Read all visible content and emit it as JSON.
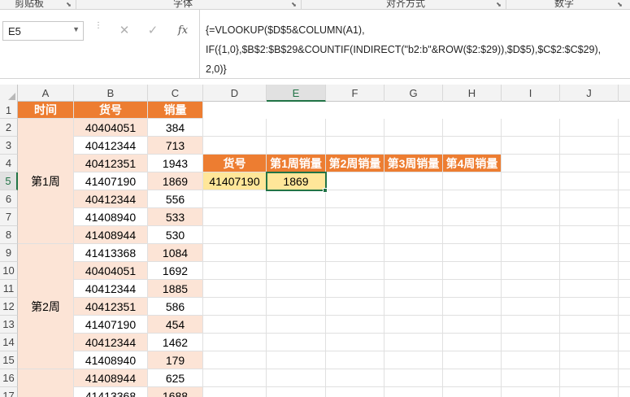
{
  "ribbon": {
    "groups": [
      {
        "label": "剪贴板"
      },
      {
        "label": "字体"
      },
      {
        "label": "对齐方式"
      },
      {
        "label": "数字"
      }
    ]
  },
  "formula_bar": {
    "name_box": "E5",
    "cancel_icon": "✕",
    "enter_icon": "✓",
    "fx_label": "fx",
    "formula": "{=VLOOKUP($D$5&COLUMN(A1),\nIF({1,0},$B$2:$B$29&COUNTIF(INDIRECT(\"b2:b\"&ROW($2:$29)),$D$5),$C$2:$C$29),\n2,0)}"
  },
  "sheet": {
    "columns": [
      "A",
      "B",
      "C",
      "D",
      "E",
      "F",
      "G",
      "H",
      "I",
      "J"
    ],
    "rows": [
      "1",
      "2",
      "3",
      "4",
      "5",
      "6",
      "7",
      "8",
      "9",
      "10",
      "11",
      "12",
      "13",
      "14",
      "15",
      "16",
      "17"
    ],
    "selected_cell": "E5",
    "header_row": {
      "a": "时间",
      "b": "货号",
      "c": "销量"
    },
    "week_labels": {
      "week1": "第1周",
      "week2": "第2周"
    },
    "data_rows": [
      {
        "row": "2",
        "b": "40404051",
        "c": "384"
      },
      {
        "row": "3",
        "b": "40412344",
        "c": "713"
      },
      {
        "row": "4",
        "b": "40412351",
        "c": "1943"
      },
      {
        "row": "5",
        "b": "41407190",
        "c": "1869"
      },
      {
        "row": "6",
        "b": "40412344",
        "c": "556"
      },
      {
        "row": "7",
        "b": "41408940",
        "c": "533"
      },
      {
        "row": "8",
        "b": "41408944",
        "c": "530"
      },
      {
        "row": "9",
        "b": "41413368",
        "c": "1084"
      },
      {
        "row": "10",
        "b": "40404051",
        "c": "1692"
      },
      {
        "row": "11",
        "b": "40412344",
        "c": "1885"
      },
      {
        "row": "12",
        "b": "40412351",
        "c": "586"
      },
      {
        "row": "13",
        "b": "41407190",
        "c": "454"
      },
      {
        "row": "14",
        "b": "40412344",
        "c": "1462"
      },
      {
        "row": "15",
        "b": "41408940",
        "c": "179"
      },
      {
        "row": "16",
        "b": "41408944",
        "c": "625"
      },
      {
        "row": "17",
        "b": "41413368",
        "c": "1688"
      }
    ],
    "lookup_header": {
      "d": "货号",
      "e": "第1周销量",
      "f": "第2周销量",
      "g": "第3周销量",
      "h": "第4周销量"
    },
    "lookup_values": {
      "d": "41407190",
      "e": "1869"
    }
  },
  "colors": {
    "header_orange": "#ed7d31",
    "peach": "#fce4d6",
    "result_yellow": "#ffe699",
    "excel_green": "#217346"
  }
}
